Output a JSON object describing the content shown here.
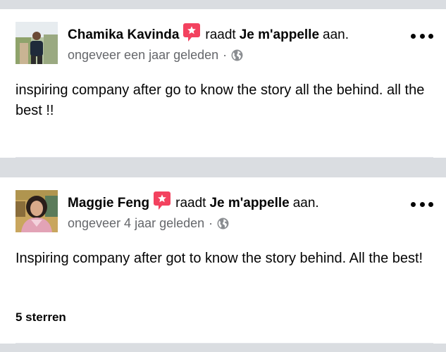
{
  "reviews": [
    {
      "reviewer_name": "Chamika Kavinda",
      "verb": "raadt",
      "page_name": "Je m'appelle",
      "suffix": "aan.",
      "time": "ongeveer een jaar geleden",
      "separator": "·",
      "text": "inspiring company after go to know the story all the behind. all the best !!",
      "avatar_icon": "avatar-photo",
      "recommend_icon": "recommend-star-bubble-icon",
      "audience_icon": "globe-icon"
    },
    {
      "reviewer_name": "Maggie Feng",
      "verb": "raadt",
      "page_name": "Je m'appelle",
      "suffix": "aan.",
      "time": "ongeveer 4 jaar geleden",
      "separator": "·",
      "text": "Inspiring company after got to know the story behind. All the best!",
      "rating": "5 sterren",
      "avatar_icon": "avatar-photo",
      "recommend_icon": "recommend-star-bubble-icon",
      "audience_icon": "globe-icon"
    }
  ],
  "colors": {
    "background": "#dadde1",
    "card": "#ffffff",
    "text": "#050505",
    "secondary_text": "#65676b",
    "recommend_badge": "#f3425f"
  }
}
